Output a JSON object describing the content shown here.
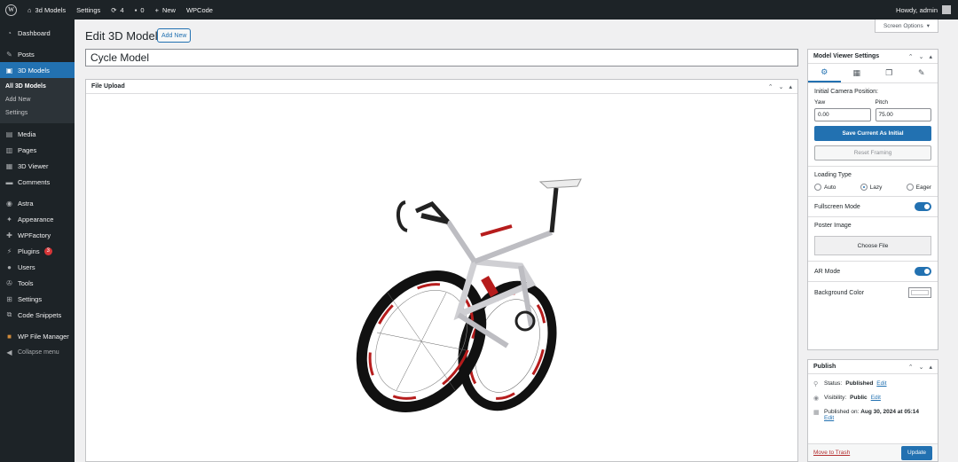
{
  "adminbar": {
    "site_name": "3d Models",
    "settings": "Settings",
    "updates_count": "4",
    "comments_count": "0",
    "new_label": "New",
    "plugin": "WPCode",
    "howdy": "Howdy, admin"
  },
  "sidebar": {
    "dashboard": "Dashboard",
    "posts": "Posts",
    "models": "3D Models",
    "sub": [
      "All 3D Models",
      "Add New",
      "Settings"
    ],
    "media": "Media",
    "pages": "Pages",
    "viewer": "3D Viewer",
    "comments": "Comments",
    "astra": "Astra",
    "appearance": "Appearance",
    "wpfactory": "WPFactory",
    "plugins": "Plugins",
    "plugins_badge": "3",
    "users": "Users",
    "tools": "Tools",
    "settings": "Settings",
    "snippets": "Code Snippets",
    "file_manager": "WP File Manager",
    "collapse": "Collapse menu"
  },
  "page": {
    "title": "Edit 3D Model",
    "add_new": "Add New",
    "screen_options": "Screen Options",
    "post_title": "Cycle Model"
  },
  "upload": {
    "heading": "File Upload"
  },
  "settings": {
    "heading": "Model Viewer Settings",
    "camera_label": "Initial Camera Position:",
    "yaw_label": "Yaw",
    "yaw_value": "0.00",
    "pitch_label": "Pitch",
    "pitch_value": "75.00",
    "save_btn": "Save Current As Initial",
    "reset_btn": "Reset Framing",
    "loading_label": "Loading Type",
    "loading_options": [
      "Auto",
      "Lazy",
      "Eager"
    ],
    "loading_selected": "Lazy",
    "fullscreen_label": "Fullscreen Mode",
    "fullscreen_on": true,
    "poster_label": "Poster Image",
    "choose_file": "Choose File",
    "ar_label": "AR Mode",
    "ar_on": true,
    "bg_label": "Background Color",
    "bg_color": "#ffffff"
  },
  "publish": {
    "heading": "Publish",
    "status_label": "Status:",
    "status_value": "Published",
    "visibility_label": "Visibility:",
    "visibility_value": "Public",
    "published_label": "Published on:",
    "published_value": "Aug 30, 2024 at 05:14",
    "edit": "Edit",
    "trash": "Move to Trash",
    "update": "Update"
  },
  "colors": {
    "accent": "#2271b1",
    "sidebar": "#1d2327",
    "danger": "#d63638"
  }
}
